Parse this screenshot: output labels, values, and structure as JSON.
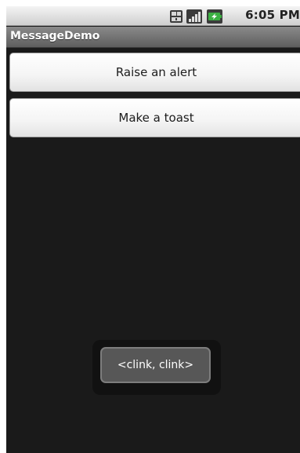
{
  "status_bar": {
    "time": "6:05 PM",
    "icons": [
      "sim-card-icon",
      "signal-strength-icon",
      "battery-charging-icon"
    ],
    "battery_color": "#3cb043"
  },
  "title_bar": {
    "title": "MessageDemo"
  },
  "buttons": {
    "raise_alert": "Raise an alert",
    "make_toast": "Make a toast"
  },
  "toast": {
    "message": "<clink, clink>"
  }
}
